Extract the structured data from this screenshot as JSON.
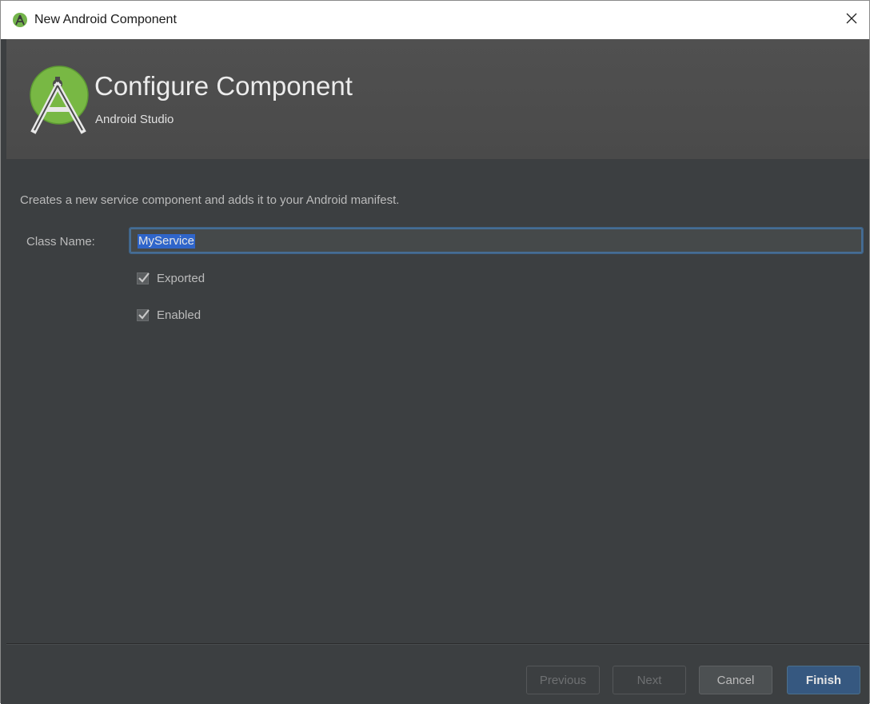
{
  "window": {
    "title": "New Android Component",
    "close_glyph": "✕"
  },
  "header": {
    "title": "Configure Component",
    "subtitle": "Android Studio",
    "logo_icon": "android-studio-logo-icon"
  },
  "form": {
    "description": "Creates a new service component and adds it to your Android manifest.",
    "class_name_label": "Class Name:",
    "class_name_value": "MyService",
    "checkboxes": [
      {
        "label": "Exported",
        "checked": true
      },
      {
        "label": "Enabled",
        "checked": true
      }
    ]
  },
  "footer": {
    "previous_label": "Previous",
    "next_label": "Next",
    "cancel_label": "Cancel",
    "finish_label": "Finish"
  },
  "colors": {
    "background": "#3c3f41",
    "header_band": "#4e4e4e",
    "accent": "#365880",
    "selection": "#2f65ca"
  }
}
